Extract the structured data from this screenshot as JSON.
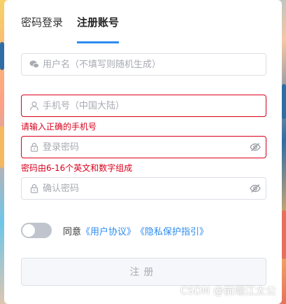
{
  "tabs": [
    {
      "label": "密码登录",
      "active": false
    },
    {
      "label": "注册账号",
      "active": true
    }
  ],
  "form": {
    "username": {
      "placeholder": "用户名（不填写则随机生成）",
      "value": "",
      "icon": "wechat-icon"
    },
    "phone": {
      "placeholder": "手机号（中国大陆）",
      "value": "",
      "icon": "user-icon",
      "error": "请输入正确的手机号"
    },
    "password": {
      "placeholder": "登录密码",
      "value": "",
      "icon": "lock-icon",
      "error": "密码由6-16个英文和数字组成"
    },
    "confirm": {
      "placeholder": "确认密码",
      "value": "",
      "icon": "lock-icon"
    }
  },
  "agreement": {
    "enabled": false,
    "prefix": "同意",
    "user_agreement": "《用户协议》",
    "privacy": "《隐私保护指引》"
  },
  "submit_label": "注册",
  "watermark": "CSDN @前端江太公",
  "colors": {
    "accent": "#2d8cf0",
    "error": "#d9001b",
    "border": "#dcdfe6",
    "placeholder": "#a8abb2"
  }
}
